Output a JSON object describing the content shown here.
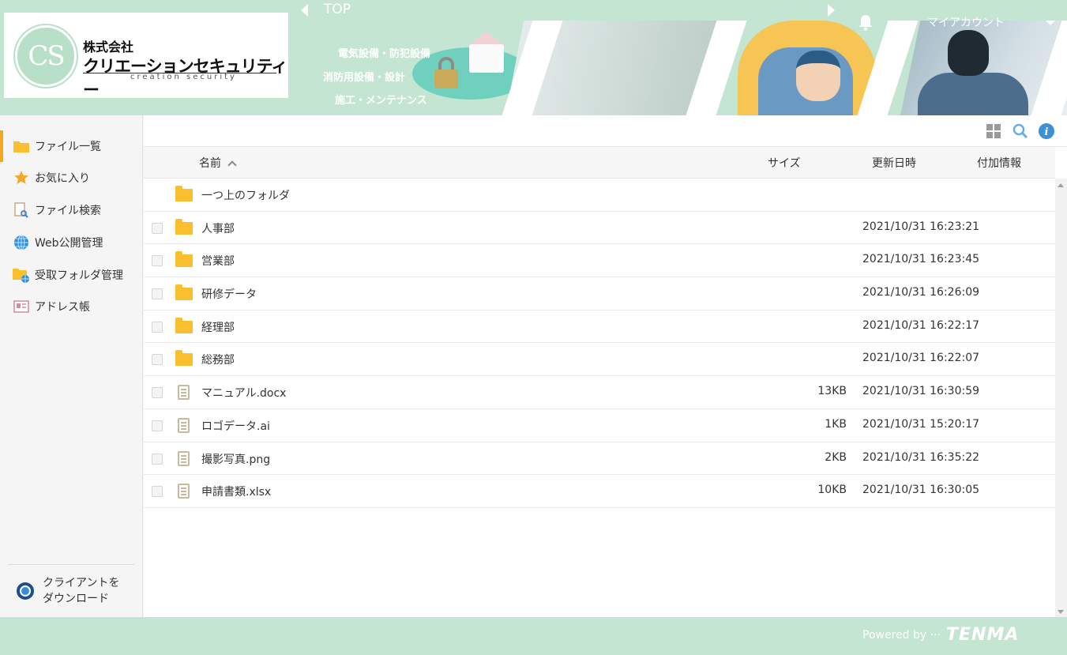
{
  "header": {
    "logo": {
      "mark": "CS",
      "company_line1": "株式会社",
      "company_line2": "クリエーションセキュリティー",
      "company_romaji": "creation security"
    },
    "top_label": "TOP",
    "banner_lines": [
      "電気設備・防犯設備",
      "消防用設備・設計",
      "施工・メンテナンス"
    ],
    "account_label": "マイアカウント",
    "colors": {
      "header_bg": "#c4e5d2",
      "accent": "#f5a623",
      "folder": "#f9bf2f"
    }
  },
  "sidebar": {
    "items": [
      {
        "label": "ファイル一覧",
        "icon": "folder-icon",
        "active": true
      },
      {
        "label": "お気に入り",
        "icon": "star-icon",
        "active": false
      },
      {
        "label": "ファイル検索",
        "icon": "file-search-icon",
        "active": false
      },
      {
        "label": "Web公開管理",
        "icon": "globe-icon",
        "active": false
      },
      {
        "label": "受取フォルダ管理",
        "icon": "folder-globe-icon",
        "active": false
      },
      {
        "label": "アドレス帳",
        "icon": "address-book-icon",
        "active": false
      }
    ],
    "download_line1": "クライアントを",
    "download_line2": "ダウンロード"
  },
  "table": {
    "columns": {
      "name": "名前",
      "size": "サイズ",
      "modified": "更新日時",
      "extra": "付加情報"
    },
    "parent_folder": "一つ上のフォルダ",
    "rows": [
      {
        "type": "folder",
        "name": "人事部",
        "size": "",
        "modified": "2021/10/31 16:23:21"
      },
      {
        "type": "folder",
        "name": "営業部",
        "size": "",
        "modified": "2021/10/31 16:23:45"
      },
      {
        "type": "folder",
        "name": "研修データ",
        "size": "",
        "modified": "2021/10/31 16:26:09"
      },
      {
        "type": "folder",
        "name": "経理部",
        "size": "",
        "modified": "2021/10/31 16:22:17"
      },
      {
        "type": "folder",
        "name": "総務部",
        "size": "",
        "modified": "2021/10/31 16:22:07"
      },
      {
        "type": "file",
        "name": "マニュアル.docx",
        "size": "13KB",
        "modified": "2021/10/31 16:30:59"
      },
      {
        "type": "file",
        "name": "ロゴデータ.ai",
        "size": "1KB",
        "modified": "2021/10/31 15:20:17"
      },
      {
        "type": "file",
        "name": "撮影写真.png",
        "size": "2KB",
        "modified": "2021/10/31 16:35:22"
      },
      {
        "type": "file",
        "name": "申請書類.xlsx",
        "size": "10KB",
        "modified": "2021/10/31 16:30:05"
      }
    ]
  },
  "footer": {
    "powered_by": "Powered by ···",
    "brand": "TENMA"
  }
}
